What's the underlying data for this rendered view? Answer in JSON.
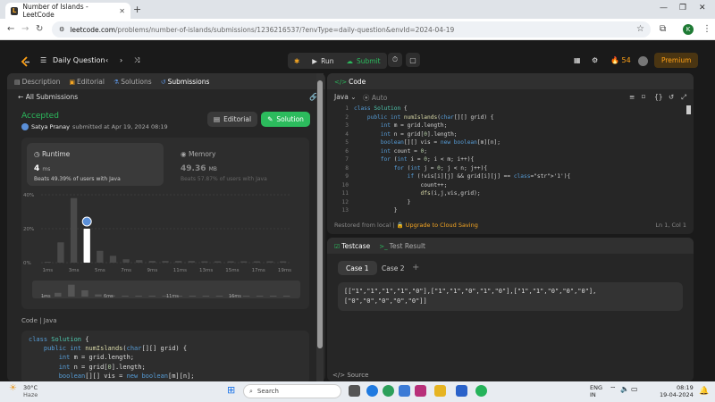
{
  "browser": {
    "tab_title": "Number of Islands - LeetCode",
    "url_host": "leetcode.com",
    "url_rest": "/problems/number-of-islands/submissions/1236216537/?envType=daily-question&envId=2024-04-19",
    "profile_initial": "K"
  },
  "header": {
    "daily_label": "Daily Question",
    "run_label": "Run",
    "submit_label": "Submit",
    "streak": "54",
    "premium_label": "Premium"
  },
  "left_tabs": [
    "Description",
    "Editorial",
    "Solutions",
    "Submissions"
  ],
  "submission": {
    "back_label": "All Submissions",
    "status": "Accepted",
    "author": "Satya Pranay",
    "submitted_text": "submitted at Apr 19, 2024 08:19",
    "editorial_btn": "Editorial",
    "solution_btn": "Solution"
  },
  "stats": {
    "runtime_label": "Runtime",
    "runtime_value": "4",
    "runtime_unit": "ms",
    "runtime_beats": "Beats 49.39% of users with Java",
    "memory_label": "Memory",
    "memory_value": "49.36",
    "memory_unit": "MB",
    "memory_beats": "Beats 57.87% of users with Java"
  },
  "chart_data": {
    "type": "bar",
    "categories": [
      "1ms",
      "2ms",
      "3ms",
      "4ms",
      "5ms",
      "6ms",
      "7ms",
      "8ms",
      "9ms",
      "10ms",
      "11ms",
      "12ms",
      "13ms",
      "14ms",
      "15ms",
      "16ms",
      "17ms",
      "18ms",
      "19ms"
    ],
    "values": [
      0.5,
      12,
      38,
      20,
      7,
      4,
      2,
      1.5,
      1,
      1,
      1,
      1,
      0.8,
      0.8,
      0.8,
      0.8,
      0.8,
      0.8,
      0.8
    ],
    "highlight_index": 3,
    "ylim": [
      0,
      40
    ],
    "y_ticks": [
      "0%",
      "20%",
      "40%"
    ],
    "x_tick_labels": [
      "1ms",
      "3ms",
      "5ms",
      "7ms",
      "9ms",
      "11ms",
      "13ms",
      "15ms",
      "17ms",
      "19ms"
    ],
    "mini_labels": [
      "1ms",
      "6ms",
      "11ms",
      "16ms"
    ],
    "accent": "#ffffff",
    "bar_color": "#4a4a4a"
  },
  "left_code": {
    "label": "Code",
    "lang": "Java",
    "lines": [
      "class Solution {",
      "    public int numIslands(char[][] grid) {",
      "        int m = grid.length;",
      "        int n = grid[0].length;",
      "        boolean[][] vis = new boolean[m][n];"
    ]
  },
  "code_panel": {
    "title": "Code",
    "lang": "Java",
    "mode": "Auto",
    "line_numbers": [
      "1",
      "2",
      "3",
      "4",
      "5",
      "6",
      "7",
      "8",
      "9",
      "10",
      "11",
      "12",
      "13"
    ],
    "lines": [
      "class Solution {",
      "    public int numIslands(char[][] grid) {",
      "        int m = grid.length;",
      "        int n = grid[0].length;",
      "        boolean[][] vis = new boolean[m][n];",
      "        int count = 0;",
      "        for (int i = 0; i < m; i++){",
      "            for (int j = 0; j < n; j++){",
      "                if (!vis[i][j] && grid[i][j] == '1'){",
      "                    count++;",
      "                    dfs(i,j,vis,grid);",
      "                }",
      "            }"
    ],
    "restored": "Restored from local",
    "cloud": "Upgrade to Cloud Saving",
    "position": "Ln 1, Col 1"
  },
  "test_panel": {
    "testcase_tab": "Testcase",
    "result_tab": "Test Result",
    "cases": [
      "Case 1",
      "Case 2"
    ],
    "input_line1": "[[\"1\",\"1\",\"1\",\"1\",\"0\"],[\"1\",\"1\",\"0\",\"1\",\"0\"],[\"1\",\"1\",\"0\",\"0\",\"0\"],",
    "input_line2": "[\"0\",\"0\",\"0\",\"0\",\"0\"]]",
    "source_label": "Source"
  },
  "taskbar": {
    "temp": "30°C",
    "weather": "Haze",
    "search": "Search",
    "lang1": "ENG",
    "lang2": "IN",
    "time": "08:19",
    "date": "19-04-2024"
  }
}
